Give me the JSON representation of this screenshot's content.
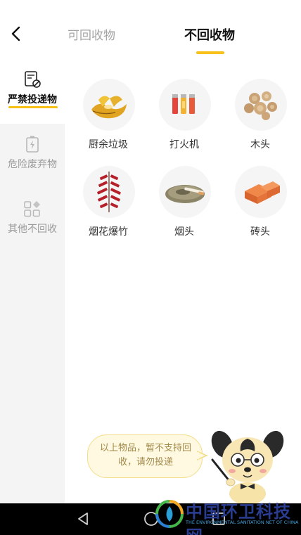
{
  "header": {
    "tabs": [
      {
        "label": "可回收物",
        "active": false
      },
      {
        "label": "不回收物",
        "active": true
      }
    ],
    "accent_color": "#f7c11a"
  },
  "sidebar": {
    "items": [
      {
        "label": "严禁投递物",
        "icon": "forbidden-item-icon",
        "active": true
      },
      {
        "label": "危险废弃物",
        "icon": "battery-icon",
        "active": false
      },
      {
        "label": "其他不回收",
        "icon": "grid-icon",
        "active": false
      }
    ]
  },
  "items": [
    {
      "label": "厨余垃圾",
      "icon": "banana-peel-icon"
    },
    {
      "label": "打火机",
      "icon": "lighter-icon"
    },
    {
      "label": "木头",
      "icon": "wood-slices-icon"
    },
    {
      "label": "烟花爆竹",
      "icon": "firecracker-icon"
    },
    {
      "label": "烟头",
      "icon": "cigarette-icon"
    },
    {
      "label": "砖头",
      "icon": "brick-icon"
    }
  ],
  "bubble": {
    "text": "以上物品，暂不支持回收，请勿投递"
  },
  "watermark": {
    "title": "中国环卫科技网",
    "subtitle": "THE ENVIRONMENTAL SANITATION NET OF CHINA"
  }
}
